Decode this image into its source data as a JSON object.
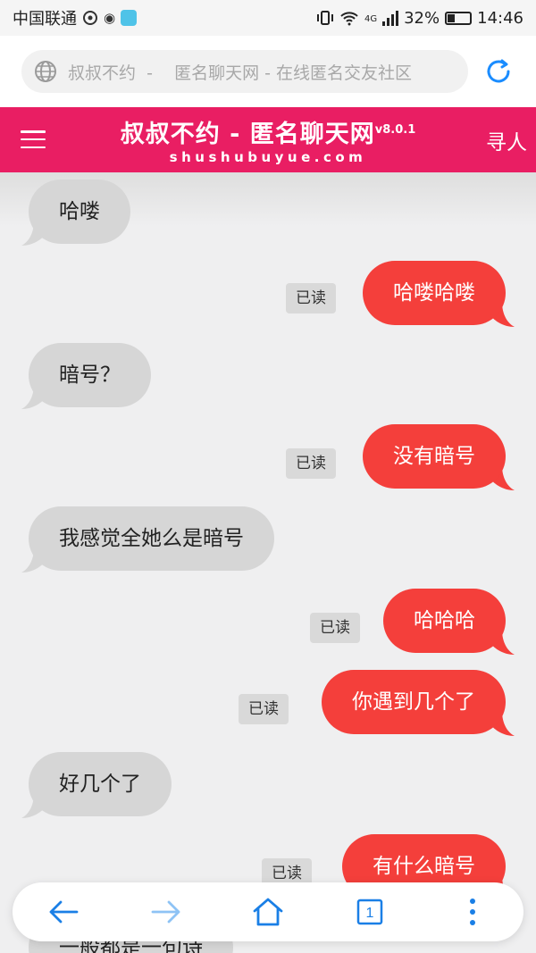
{
  "status_bar": {
    "carrier": "中国联通",
    "network": "4G",
    "battery": "32%",
    "battery_level": 0.32,
    "time": "14:46"
  },
  "browser": {
    "url_text": "叔叔不约  -    匿名聊天网 - 在线匿名交友社区",
    "tab_count": "1"
  },
  "site": {
    "title": "叔叔不约 - 匿名聊天网",
    "version": "v8.0.1",
    "domain": "shushubuyue.com",
    "find_people": "寻人",
    "brand_color": "#e91e63"
  },
  "chat": {
    "incoming_color": "#d6d6d6",
    "outgoing_color": "#f43f3b",
    "read_label": "已读",
    "messages": [
      {
        "side": "in",
        "text": "哈喽"
      },
      {
        "side": "out",
        "text": "哈喽哈喽",
        "read": "已读"
      },
      {
        "side": "in",
        "text": "暗号？"
      },
      {
        "side": "out",
        "text": "没有暗号",
        "read": "已读"
      },
      {
        "side": "in",
        "text": "我感觉全她么是暗号"
      },
      {
        "side": "out",
        "text": "哈哈哈",
        "read": "已读"
      },
      {
        "side": "out",
        "text": "你遇到几个了",
        "read": "已读"
      },
      {
        "side": "in",
        "text": "好几个了"
      },
      {
        "side": "out",
        "text": "有什么暗号",
        "read": "已读"
      },
      {
        "side": "in",
        "text": "一般都是一句诗"
      }
    ]
  },
  "nav_icons": [
    "back-arrow-icon",
    "forward-arrow-icon",
    "home-icon",
    "tabs-icon",
    "more-icon"
  ]
}
